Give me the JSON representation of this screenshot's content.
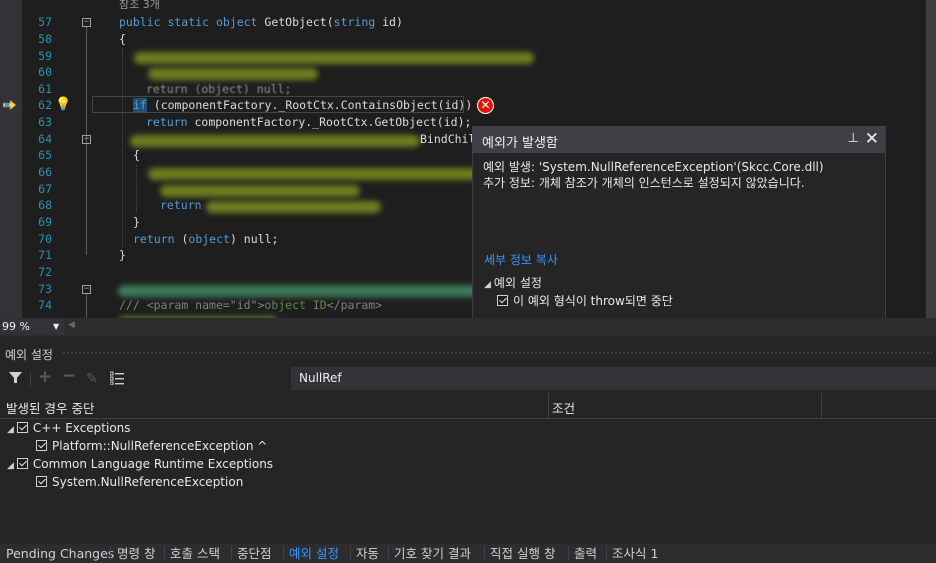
{
  "editor": {
    "ref_count": "참조 3개",
    "lines": [
      {
        "n": "57"
      },
      {
        "n": "58"
      },
      {
        "n": "59"
      },
      {
        "n": "60"
      },
      {
        "n": "61"
      },
      {
        "n": "62"
      },
      {
        "n": "63"
      },
      {
        "n": "64"
      },
      {
        "n": "65"
      },
      {
        "n": "66"
      },
      {
        "n": "67"
      },
      {
        "n": "68"
      },
      {
        "n": "69"
      },
      {
        "n": "70"
      },
      {
        "n": "71"
      },
      {
        "n": "72"
      },
      {
        "n": "73"
      },
      {
        "n": "74"
      }
    ],
    "code": {
      "l57_a": "public static ",
      "l57_b": "object",
      "l57_c": " GetObject(",
      "l57_d": "string",
      "l57_e": " id)",
      "l58": "{",
      "l61": "return (object) null;",
      "l62_if": "if",
      "l62_rest": " (componentFactory._RootCtx.ContainsObject(id))",
      "l63_a": "return",
      "l63_b": " componentFactory._RootCtx.GetObject(id);",
      "l64_tail": "BindChildCo",
      "l65": "{",
      "l68": "return",
      "l69": "}",
      "l70_a": "return",
      "l70_b": " (",
      "l70_c": "object",
      "l70_d": ") null;",
      "l71": "}",
      "l74_a": "/// ",
      "l74_b": "<param name=\"id\">",
      "l74_c": "object ID",
      "l74_d": "</param>"
    }
  },
  "exception_popup": {
    "title": "예외가 발생함",
    "pin_icon": "📌",
    "close_icon": "✕",
    "line1": "예외 발생: 'System.NullReferenceException'(Skcc.Core.dll)",
    "line2": "추가 정보: 개체 참조가 개체의 인스턴스로 설정되지 않았습니다.",
    "copy_details": "세부 정보 복사",
    "settings_header": "예외 설정",
    "break_when_thrown": "이 예외 형식이 throw되면 중단"
  },
  "zoom": {
    "value": "99 %"
  },
  "exception_settings": {
    "title": "예외 설정",
    "search_value": "NullRef",
    "col_break": "발생된 경우 중단",
    "col_condition": "조건",
    "tree": [
      {
        "label": "C++ Exceptions",
        "checked": true,
        "level": 0
      },
      {
        "label": "Platform::NullReferenceException ^",
        "checked": true,
        "level": 1
      },
      {
        "label": "Common Language Runtime Exceptions",
        "checked": true,
        "level": 0
      },
      {
        "label": "System.NullReferenceException",
        "checked": true,
        "level": 1
      }
    ]
  },
  "tabs": [
    {
      "label": "Pending Changes"
    },
    {
      "label": "명령 창"
    },
    {
      "label": "호출 스택"
    },
    {
      "label": "중단점"
    },
    {
      "label": "예외 설정",
      "active": true
    },
    {
      "label": "자동"
    },
    {
      "label": "기호 찾기 결과"
    },
    {
      "label": "직접 실행 창"
    },
    {
      "label": "출력"
    },
    {
      "label": "조사식 1"
    }
  ],
  "colors": {
    "editor_bg": "#1e1e1e",
    "keyword": "#569cd6",
    "type": "#4ec9b0",
    "line_number": "#2b91af",
    "link": "#3794ff",
    "error": "#e51400"
  }
}
